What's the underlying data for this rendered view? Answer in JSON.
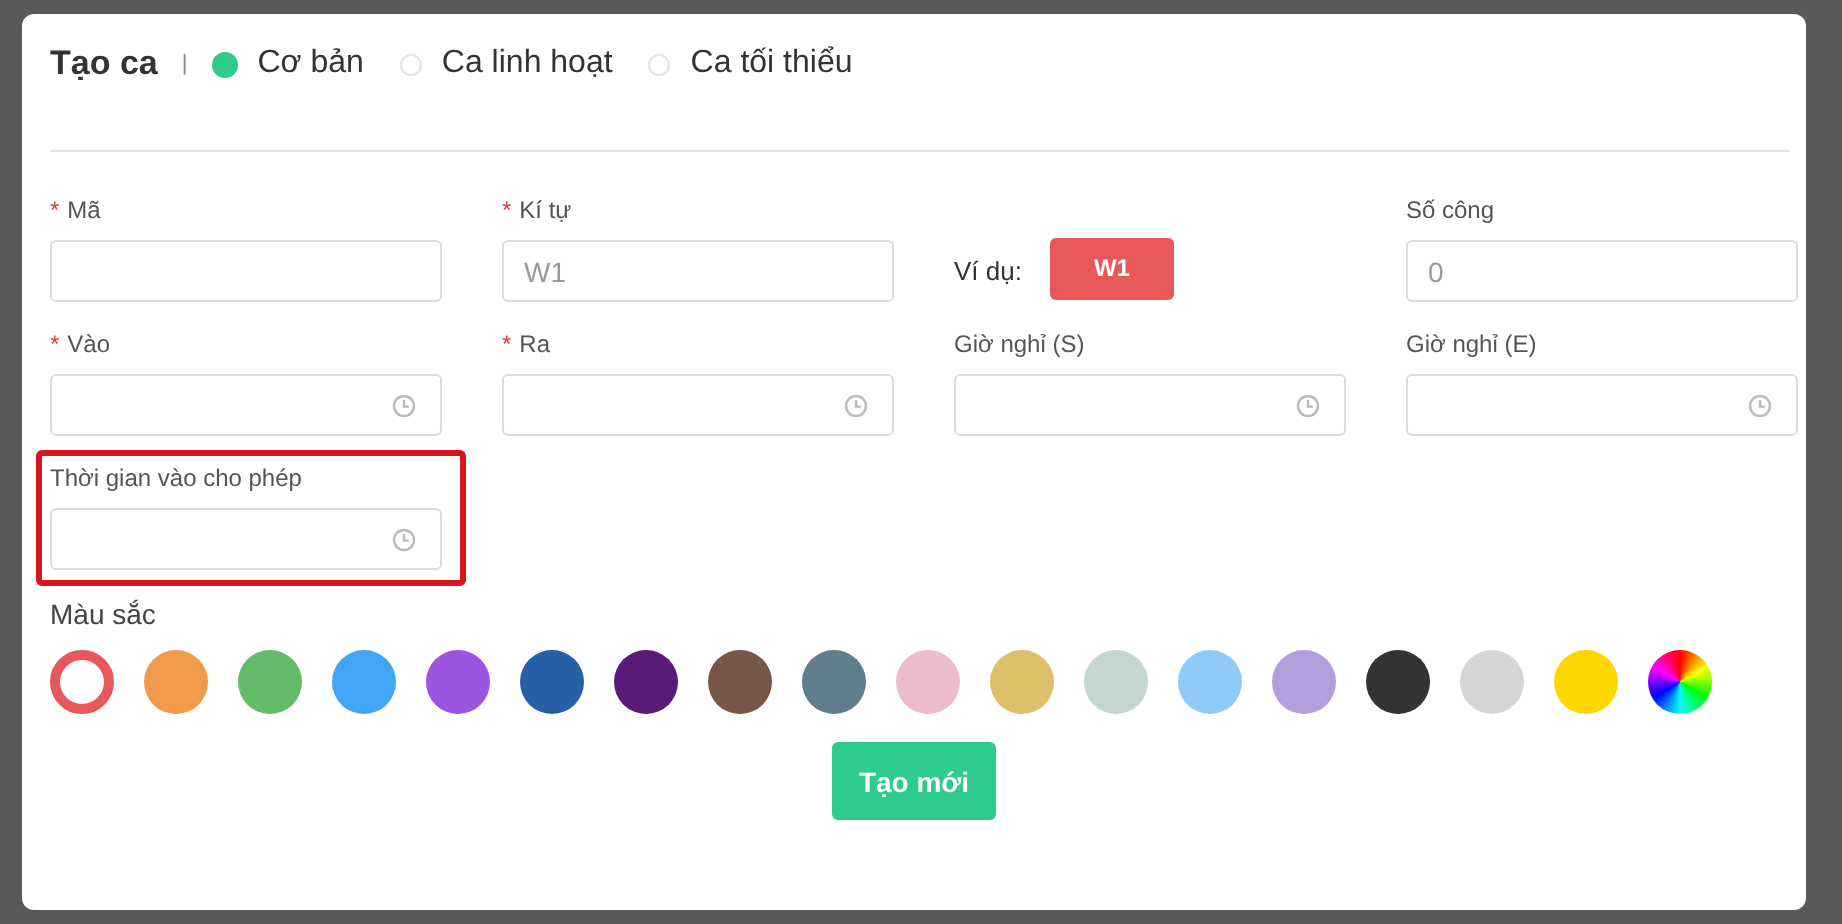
{
  "dialog": {
    "title": "Tạo ca",
    "separator": "|",
    "shift_types": [
      {
        "label": "Cơ bản",
        "selected": true
      },
      {
        "label": "Ca linh hoạt",
        "selected": false
      },
      {
        "label": "Ca tối thiểu",
        "selected": false
      }
    ]
  },
  "rows": [
    [
      {
        "kind": "text",
        "label": "Mã",
        "required_mark": "*"
      },
      {
        "kind": "text",
        "label": "Kí tự",
        "required_mark": "*",
        "placeholder": "W1"
      },
      {
        "kind": "example",
        "label": "Ví dụ:",
        "badge": "W1"
      },
      {
        "kind": "text",
        "label": "Số công",
        "placeholder": "0"
      }
    ],
    [
      {
        "kind": "time",
        "label": "Vào",
        "required_mark": "*"
      },
      {
        "kind": "time",
        "label": "Ra",
        "required_mark": "*"
      },
      {
        "kind": "time",
        "label": "Giờ nghỉ (S)"
      },
      {
        "kind": "time",
        "label": "Giờ nghỉ (E)"
      }
    ],
    [
      {
        "kind": "time",
        "label": "Thời gian vào cho phép",
        "highlighted": true
      }
    ]
  ],
  "colors": {
    "label": "Màu sắc",
    "swatches": [
      {
        "kind": "swatch",
        "color": "#e8585a",
        "selected": true
      },
      {
        "kind": "swatch",
        "color": "#f09a4a",
        "selected": false
      },
      {
        "kind": "swatch",
        "color": "#66bb6a",
        "selected": false
      },
      {
        "kind": "swatch",
        "color": "#42a5f5",
        "selected": false
      },
      {
        "kind": "swatch",
        "color": "#9c55e0",
        "selected": false
      },
      {
        "kind": "swatch",
        "color": "#2860a8",
        "selected": false
      },
      {
        "kind": "swatch",
        "color": "#5a1a78",
        "selected": false
      },
      {
        "kind": "swatch",
        "color": "#795548",
        "selected": false
      },
      {
        "kind": "swatch",
        "color": "#607d8b",
        "selected": false
      },
      {
        "kind": "swatch",
        "color": "#ecbccb",
        "selected": false
      },
      {
        "kind": "swatch",
        "color": "#dcc06a",
        "selected": false
      },
      {
        "kind": "swatch",
        "color": "#c5d6d2",
        "selected": false
      },
      {
        "kind": "swatch",
        "color": "#90caf9",
        "selected": false
      },
      {
        "kind": "swatch",
        "color": "#b39ddb",
        "selected": false
      },
      {
        "kind": "swatch",
        "color": "#333333",
        "selected": false
      },
      {
        "kind": "swatch",
        "color": "#d6d6d6",
        "selected": false
      },
      {
        "kind": "swatch",
        "color": "#ffd600",
        "selected": false
      },
      {
        "kind": "picker",
        "selected": false
      }
    ]
  },
  "submit_button": "Tạo mới"
}
